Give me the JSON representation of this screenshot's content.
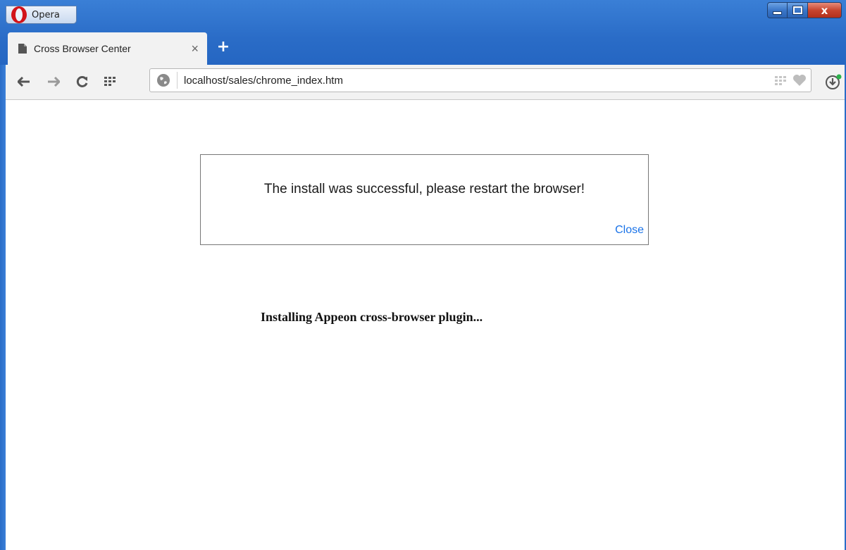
{
  "window": {
    "menu_label": "Opera",
    "close_glyph": "x"
  },
  "tab": {
    "title": "Cross Browser Center",
    "close_glyph": "×",
    "new_tab_glyph": "+"
  },
  "toolbar": {
    "address": "localhost/sales/chrome_index.htm"
  },
  "page": {
    "dialog_message": "The install was successful, please restart the browser!",
    "dialog_close": "Close",
    "status_text": "Installing Appeon cross-browser plugin..."
  },
  "icons": {
    "opera": "opera-logo-icon",
    "page": "page-icon",
    "back": "back-arrow-icon",
    "forward": "forward-arrow-icon",
    "reload": "reload-icon",
    "speed_dial": "speed-dial-icon",
    "site_info": "globe-icon",
    "bookmark": "heart-icon",
    "download": "download-icon"
  },
  "colors": {
    "frame_blue": "#2a6cc7",
    "close_red": "#c8452f",
    "link_blue": "#1a73e8"
  }
}
